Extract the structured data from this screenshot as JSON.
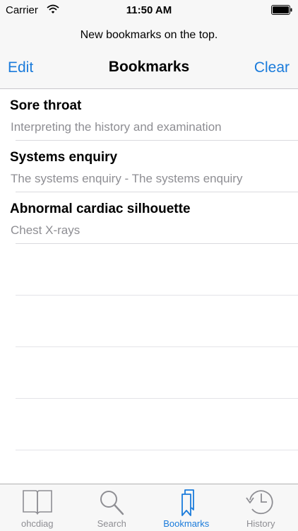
{
  "status_bar": {
    "carrier": "Carrier",
    "time": "11:50 AM"
  },
  "header": {
    "prompt": "New bookmarks on the top."
  },
  "nav": {
    "left_label": "Edit",
    "title": "Bookmarks",
    "right_label": "Clear"
  },
  "bookmarks": [
    {
      "title": "Sore throat",
      "subtitle": "Interpreting the history and examination"
    },
    {
      "title": "Systems enquiry",
      "subtitle": "The systems enquiry - The systems enquiry"
    },
    {
      "title": "Abnormal cardiac silhouette",
      "subtitle": "Chest X-rays"
    }
  ],
  "tabs": [
    {
      "label": "ohcdiag",
      "icon": "book-icon"
    },
    {
      "label": "Search",
      "icon": "magnifier-icon"
    },
    {
      "label": "Bookmarks",
      "icon": "bookmarks-icon",
      "active": true
    },
    {
      "label": "History",
      "icon": "clock-history-icon"
    }
  ],
  "colors": {
    "accent": "#1a7bdb",
    "inactive": "#8e8e93"
  }
}
